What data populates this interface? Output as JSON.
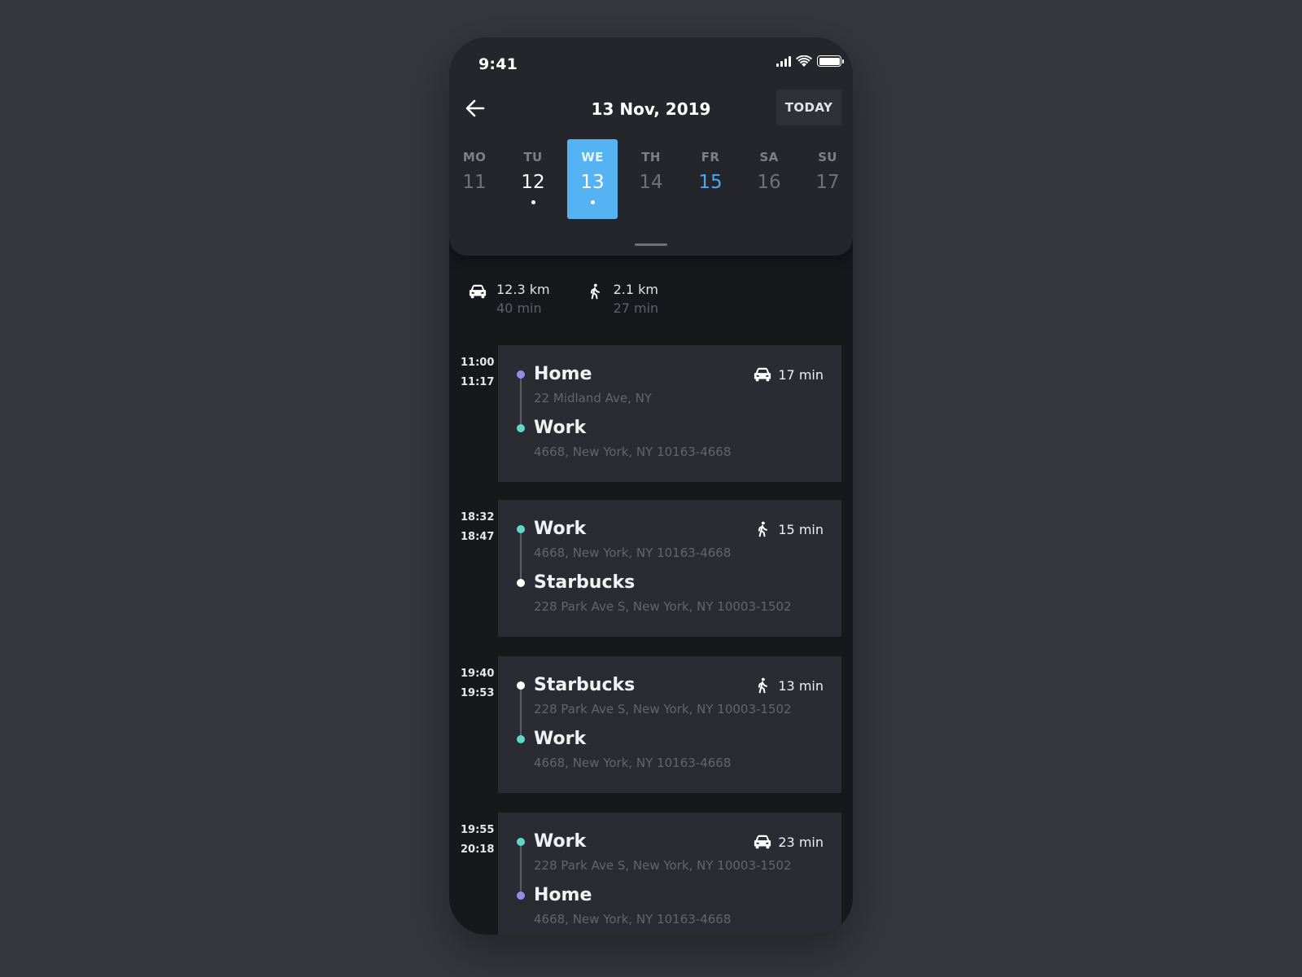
{
  "status_bar": {
    "time": "9:41"
  },
  "header": {
    "title": "13 Nov, 2019",
    "today_label": "TODAY"
  },
  "week": [
    {
      "name": "MO",
      "num": "11",
      "state": "default",
      "has_event": false
    },
    {
      "name": "TU",
      "num": "12",
      "state": "default",
      "has_event": true
    },
    {
      "name": "WE",
      "num": "13",
      "state": "selected",
      "has_event": true
    },
    {
      "name": "TH",
      "num": "14",
      "state": "default",
      "has_event": false
    },
    {
      "name": "FR",
      "num": "15",
      "state": "highlight",
      "has_event": false
    },
    {
      "name": "SA",
      "num": "16",
      "state": "default",
      "has_event": false
    },
    {
      "name": "SU",
      "num": "17",
      "state": "default",
      "has_event": false
    }
  ],
  "summary": {
    "car": {
      "icon": "car-icon",
      "distance": "12.3 km",
      "time": "40 min"
    },
    "walk": {
      "icon": "walk-icon",
      "distance": "2.1 km",
      "time": "27 min"
    }
  },
  "colors": {
    "home": "#9a8ae6",
    "work": "#5fd8c9",
    "starbucks": "#ffffff",
    "accent": "#55b3f3"
  },
  "trips": [
    {
      "start": "11:00",
      "end": "11:17",
      "mode": "car",
      "duration": "17 min",
      "from": {
        "name": "Home",
        "address": "22 Midland Ave, NY",
        "kind": "home"
      },
      "to": {
        "name": "Work",
        "address": "4668, New York, NY 10163-4668",
        "kind": "work"
      }
    },
    {
      "start": "18:32",
      "end": "18:47",
      "mode": "walk",
      "duration": "15 min",
      "from": {
        "name": "Work",
        "address": "4668, New York, NY 10163-4668",
        "kind": "work"
      },
      "to": {
        "name": "Starbucks",
        "address": "228 Park Ave S, New York, NY 10003-1502",
        "kind": "starbucks"
      }
    },
    {
      "start": "19:40",
      "end": "19:53",
      "mode": "walk",
      "duration": "13 min",
      "from": {
        "name": "Starbucks",
        "address": "228 Park Ave S, New York, NY 10003-1502",
        "kind": "starbucks"
      },
      "to": {
        "name": "Work",
        "address": "4668, New York, NY 10163-4668",
        "kind": "work"
      }
    },
    {
      "start": "19:55",
      "end": "20:18",
      "mode": "car",
      "duration": "23 min",
      "from": {
        "name": "Work",
        "address": "228 Park Ave S, New York, NY 10003-1502",
        "kind": "work"
      },
      "to": {
        "name": "Home",
        "address": "4668, New York, NY 10163-4668",
        "kind": "home"
      }
    }
  ]
}
